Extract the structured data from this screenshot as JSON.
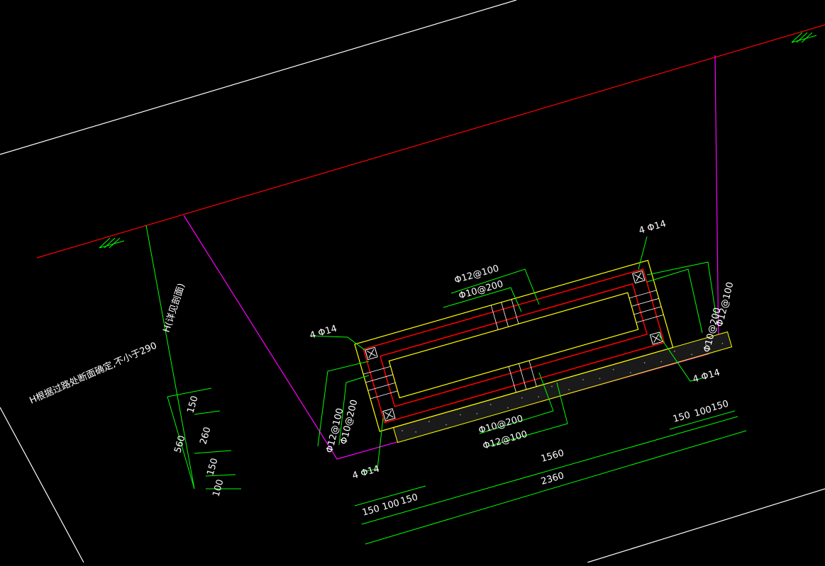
{
  "colors": {
    "background": "#000000",
    "outline": "#ffffff",
    "ground": "#ff0000",
    "excavation": "#ff00ff",
    "dimension": "#00ff00",
    "rebar": "#ff0000",
    "concrete": "#ffff00",
    "text": "#ffffff"
  },
  "labels": {
    "note": "H根据过路处断面确定,不小于290",
    "h_depth": "H(详见剖面)",
    "rebar_corner": "4 Φ14",
    "top_long": "Φ12@100",
    "top_stir": "Φ10@200",
    "bot_stir": "Φ10@200",
    "bot_long": "Φ12@100",
    "left_long": "Φ12@100",
    "left_stir": "Φ10@200",
    "right_stir": "Φ10@200",
    "right_long": "Φ12@100"
  },
  "dimensions": {
    "left_150a": "150",
    "left_260": "260",
    "left_150b": "150",
    "left_100": "100",
    "left_560": "560",
    "bot_150a": "150",
    "bot_100": "100",
    "bot_150b": "150",
    "right_150a": "150",
    "right_100": "100",
    "right_150b": "150",
    "width_1560": "1560",
    "width_2360": "2360"
  }
}
